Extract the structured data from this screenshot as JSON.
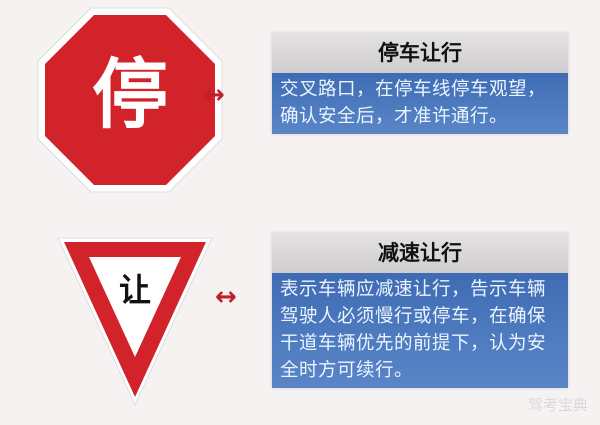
{
  "colors": {
    "sign_red": "#d2232a",
    "box_header": "#d6d4d4",
    "box_body": "#4a76bd",
    "arrow": "#c0202a"
  },
  "stop": {
    "sign_char": "停",
    "title": "停车让行",
    "description": "交叉路口，在停车线停车观望，确认安全后，才准许通行。",
    "arrow": "↔"
  },
  "yield": {
    "sign_char": "让",
    "title": "减速让行",
    "description": "表示车辆应减速让行，告示车辆驾驶人必须慢行或停车，在确保干道车辆优先的前提下，认为安全时方可续行。",
    "arrow": "↔"
  },
  "watermark": "驾考宝典"
}
